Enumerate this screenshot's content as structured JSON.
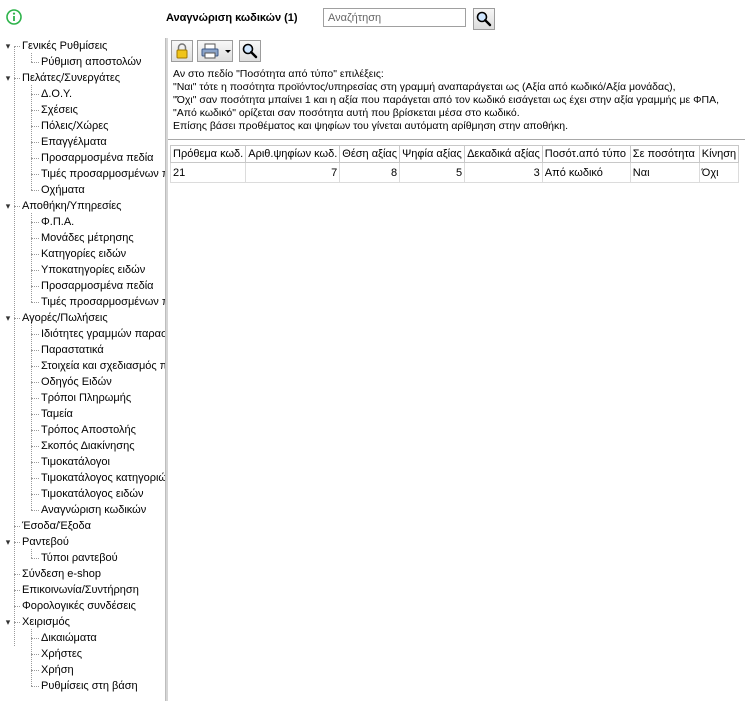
{
  "header": {
    "title": "Αναγνώριση κωδικών (1)",
    "search_placeholder": "Αναζήτηση"
  },
  "sidebar": {
    "groups": [
      {
        "label": "Γενικές Ρυθμίσεις",
        "children": [
          "Ρύθμιση αποστολών"
        ]
      },
      {
        "label": "Πελάτες/Συνεργάτες",
        "children": [
          "Δ.Ο.Υ.",
          "Σχέσεις",
          "Πόλεις/Χώρες",
          "Επαγγέλματα",
          "Προσαρμοσμένα πεδία",
          "Τιμές προσαρμοσμένων π",
          "Οχήματα"
        ]
      },
      {
        "label": "Αποθήκη/Υπηρεσίες",
        "children": [
          "Φ.Π.Α.",
          "Μονάδες μέτρησης",
          "Κατηγορίες ειδών",
          "Υποκατηγορίες ειδών",
          "Προσαρμοσμένα πεδία",
          "Τιμές προσαρμοσμένων π"
        ]
      },
      {
        "label": "Αγορές/Πωλήσεις",
        "children": [
          "Ιδιότητες γραμμών παρασ",
          "Παραστατικά",
          "Στοιχεία και σχεδιασμός π",
          "Οδηγός Ειδών",
          "Τρόποι Πληρωμής",
          "Ταμεία",
          "Τρόπος Αποστολής",
          "Σκοπός Διακίνησης",
          "Τιμοκατάλογοι",
          "Τιμοκατάλογος κατηγοριώ",
          "Τιμοκατάλογος ειδών",
          "Αναγνώριση κωδικών"
        ]
      },
      {
        "label": "Έσοδα/Έξοδα",
        "children": []
      },
      {
        "label": "Ραντεβού",
        "children": [
          "Τύποι ραντεβού"
        ]
      },
      {
        "label": "Σύνδεση e-shop",
        "children": []
      },
      {
        "label": "Επικοινωνία/Συντήρηση",
        "children": []
      },
      {
        "label": "Φορολογικές συνδέσεις",
        "children": []
      },
      {
        "label": "Χειρισμός",
        "children": [
          "Δικαιώματα",
          "Χρήστες",
          "Χρήση",
          "Ρυθμίσεις στη βάση"
        ]
      }
    ]
  },
  "description": [
    "Αν στο πεδίο \"Ποσότητα από τύπο\" επιλέξεις:",
    "\"Ναι\" τότε η ποσότητα προϊόντος/υπηρεσίας στη γραμμή αναπαράγεται ως (Αξία από κωδικό/Αξία μονάδας),",
    "\"Όχι\" σαν ποσότητα μπαίνει 1 και η αξία που παράγεται από τον κωδικό εισάγεται ως έχει στην αξία γραμμής με ΦΠΑ,",
    "\"Από κωδικό\" ορίζεται σαν ποσότητα αυτή που βρίσκεται μέσα στο κωδικό.",
    "Επίσης βάσει προθέματος και ψηφίων του γίνεται αυτόματη αρίθμηση στην αποθήκη."
  ],
  "table": {
    "columns": [
      "Πρόθεμα κωδ.",
      "Αριθ.ψηφίων κωδ.",
      "Θέση αξίας",
      "Ψηφία αξίας",
      "Δεκαδικά αξίας",
      "Ποσότ.από τύπο",
      "Σε ποσότητα",
      "Κίνηση"
    ],
    "rows": [
      [
        "21",
        "7",
        "8",
        "5",
        "3",
        "Από κωδικό",
        "Ναι",
        "Όχι"
      ]
    ]
  },
  "icons": {
    "info": "info-icon",
    "search": "search-icon",
    "lock": "lock-icon",
    "print": "printer-icon",
    "dropdown": "chevron-down-icon"
  },
  "colors": {
    "info_green": "#2db34a",
    "lock_yellow": "#f0c419"
  }
}
